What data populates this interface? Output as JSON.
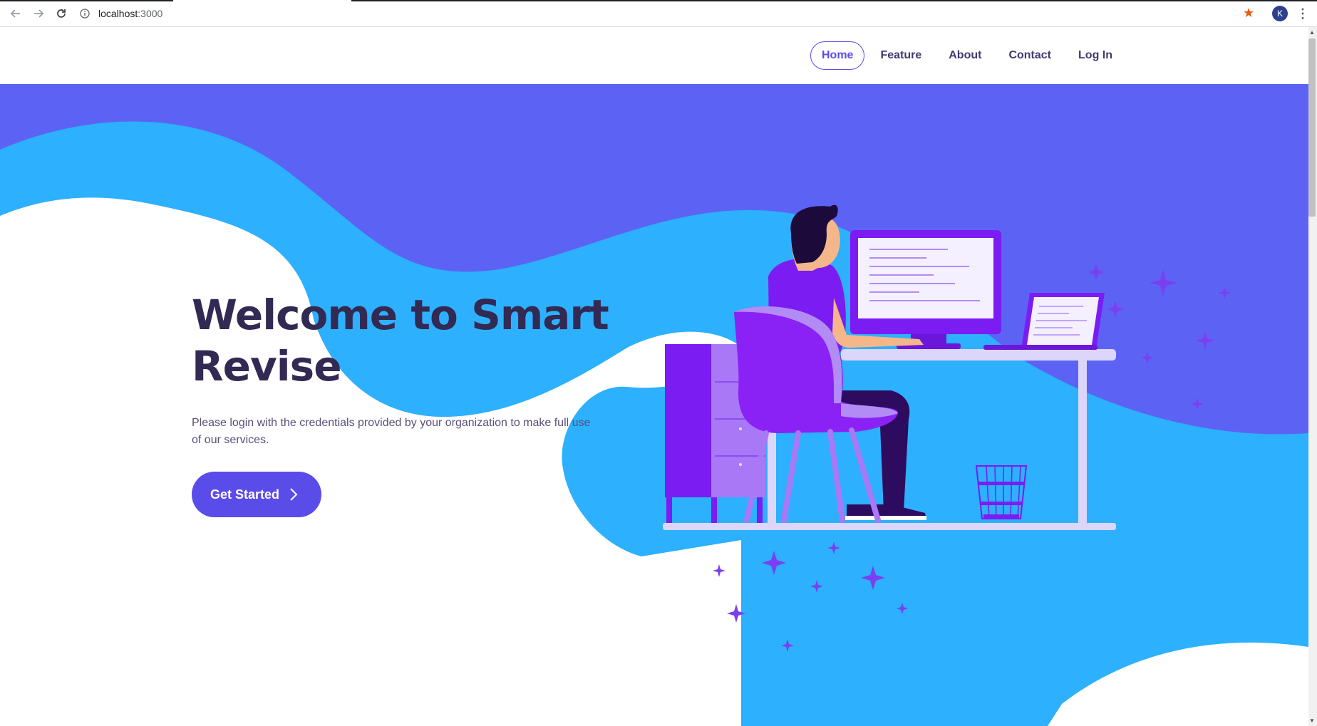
{
  "browser": {
    "url_host": "localhost",
    "url_port": ":3000",
    "profile_initial": "K"
  },
  "nav": {
    "items": [
      {
        "label": "Home",
        "active": true
      },
      {
        "label": "Feature",
        "active": false
      },
      {
        "label": "About",
        "active": false
      },
      {
        "label": "Contact",
        "active": false
      },
      {
        "label": "Log In",
        "active": false
      }
    ]
  },
  "hero": {
    "title_line1": "Welcome to Smart",
    "title_line2": "Revise",
    "subtitle": "Please login with the credentials provided by your organization to make full use of our services.",
    "cta_label": "Get Started"
  },
  "colors": {
    "brand_purple": "#5a4ce8",
    "wave_blue": "#2db0fd",
    "wave_violet": "#5c63f4",
    "heading": "#332a54"
  },
  "icons": {
    "back": "arrow-left-icon",
    "forward": "arrow-right-icon",
    "reload": "reload-icon",
    "info": "info-icon",
    "bookmark": "star-icon",
    "menu": "kebab-menu-icon",
    "cta": "chevron-right-icon"
  }
}
